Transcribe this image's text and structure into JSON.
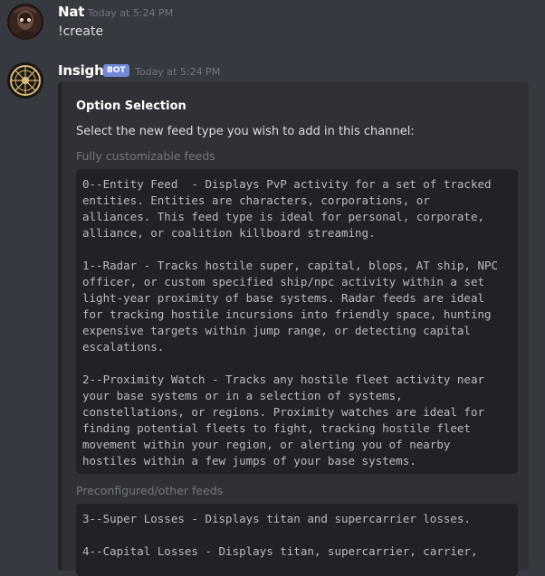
{
  "messages": [
    {
      "username": "Nat",
      "timestamp": "Today at 5:24 PM",
      "text": "!create"
    },
    {
      "username": "Insight",
      "badge": "BOT",
      "timestamp": "Today at 5:24 PM"
    }
  ],
  "embed": {
    "title": "Option Selection",
    "description": "Select the new feed type you wish to add in this channel:",
    "fields": [
      {
        "name": "Fully customizable feeds",
        "code": "0--Entity Feed  - Displays PvP activity for a set of tracked\nentities. Entities are characters, corporations, or\nalliances. This feed type is ideal for personal, corporate,\nalliance, or coalition killboard streaming.\n\n1--Radar - Tracks hostile super, capital, blops, AT ship, NPC\nofficer, or custom specified ship/npc activity within a set\nlight-year proximity of base systems. Radar feeds are ideal\nfor tracking hostile incursions into friendly space, hunting\nexpensive targets within jump range, or detecting capital\nescalations.\n\n2--Proximity Watch - Tracks any hostile fleet activity near\nyour base systems or in a selection of systems,\nconstellations, or regions. Proximity watches are ideal for\nfinding potential fleets to fight, tracking hostile fleet\nmovement within your region, or alerting you of nearby\nhostiles within a few jumps of your base systems."
      },
      {
        "name": "Preconfigured/other feeds",
        "code": "3--Super Losses - Displays titan and supercarrier losses.\n\n4--Capital Losses - Displays titan, supercarrier, carrier,"
      }
    ]
  },
  "colors": {
    "background": "#36393f",
    "embed_bg": "#2f3136",
    "code_bg": "#202225",
    "bot_badge": "#7289da",
    "muted": "#72767d"
  },
  "icons": {
    "nat_avatar": "dark-portrait-avatar",
    "insight_avatar": "wheel-emblem-avatar"
  }
}
